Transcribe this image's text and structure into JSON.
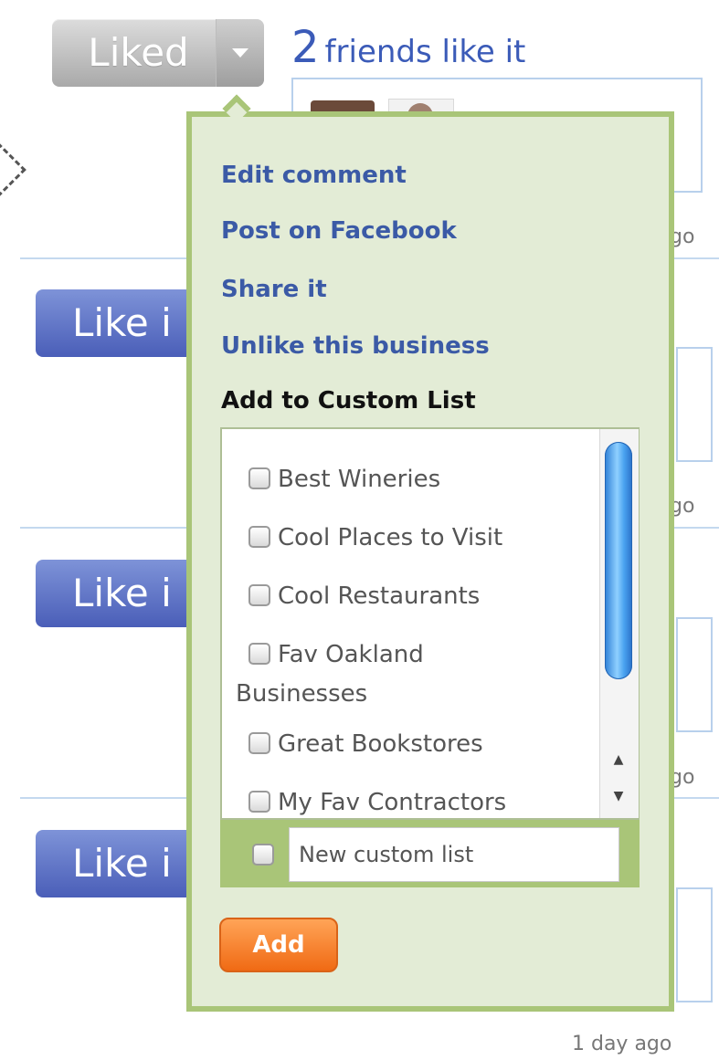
{
  "top_bar": {
    "liked_label": "Liked",
    "friends_count": "2",
    "friends_text": "friends like it"
  },
  "feed": {
    "like_button_label": "Like i",
    "timestamp_fragment": "go",
    "last_timestamp": "1 day ago"
  },
  "popup": {
    "menu": [
      {
        "label": "Edit comment"
      },
      {
        "label": "Post on Facebook"
      },
      {
        "label": "Share it"
      },
      {
        "label": "Unlike this business"
      }
    ],
    "section_title": "Add to Custom List",
    "lists": [
      {
        "label": "Best Wineries",
        "checked": false
      },
      {
        "label": "Cool Places to Visit",
        "checked": false
      },
      {
        "label": "Cool Restaurants",
        "checked": false
      },
      {
        "label_line1": "Fav Oakland",
        "label_line2": "Businesses",
        "checked": false
      },
      {
        "label": "Great Bookstores",
        "checked": false
      },
      {
        "label": "My Fav Contractors",
        "checked": false
      }
    ],
    "new_list_placeholder": "New custom list",
    "add_label": "Add"
  },
  "colors": {
    "link": "#3b5aa6",
    "popup_bg": "#e3ecd6",
    "popup_border": "#a9c578",
    "add_button": "#f06a14",
    "like_button": "#4a5eb8"
  }
}
